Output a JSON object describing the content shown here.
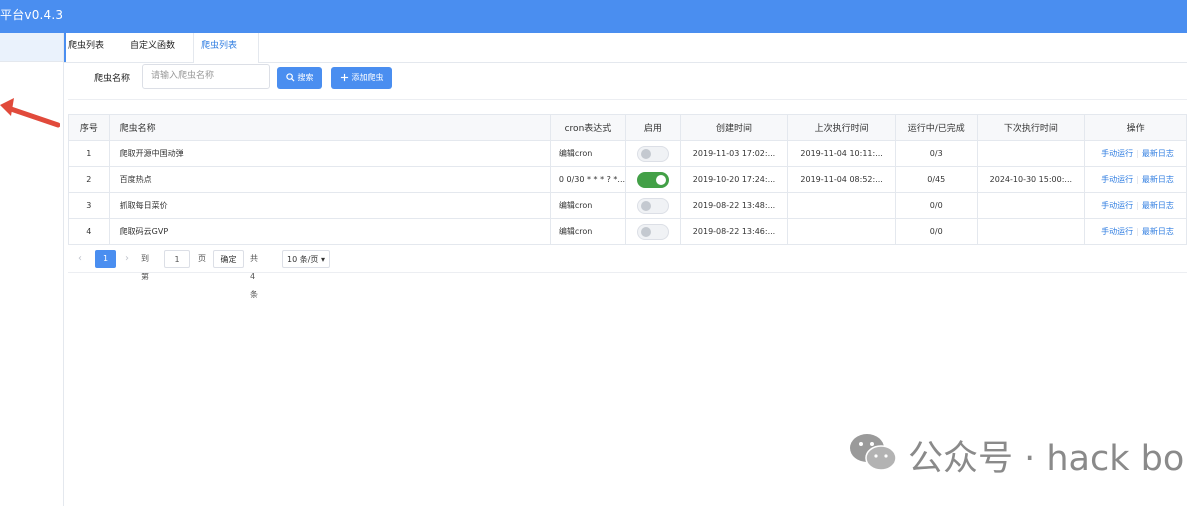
{
  "app": {
    "title": "平台v0.4.3"
  },
  "tabs": [
    {
      "label": "爬虫列表"
    },
    {
      "label": "自定义函数"
    },
    {
      "label": "爬虫列表"
    }
  ],
  "search": {
    "label": "爬虫名称",
    "placeholder": "请输入爬虫名称",
    "search_button": "搜索",
    "add_button": "添加爬虫"
  },
  "table": {
    "headers": [
      "序号",
      "爬虫名称",
      "cron表达式",
      "启用",
      "创建时间",
      "上次执行时间",
      "运行中/已完成",
      "下次执行时间",
      "操作"
    ],
    "rows": [
      {
        "index": "1",
        "name": "爬取开源中国动弹",
        "cron": "编辑cron",
        "enabled": false,
        "created": "2019-11-03 17:02:...",
        "last_run": "2019-11-04 10:11:...",
        "progress": "0/3",
        "next_run": "",
        "op_run": "手动运行",
        "op_log": "最新日志"
      },
      {
        "index": "2",
        "name": "百度热点",
        "cron": "0 0/30 * * * ? *...",
        "enabled": true,
        "created": "2019-10-20 17:24:...",
        "last_run": "2019-11-04 08:52:...",
        "progress": "0/45",
        "next_run": "2024-10-30 15:00:...",
        "op_run": "手动运行",
        "op_log": "最新日志"
      },
      {
        "index": "3",
        "name": "抓取每日菜价",
        "cron": "编辑cron",
        "enabled": false,
        "created": "2019-08-22 13:48:...",
        "last_run": "",
        "progress": "0/0",
        "next_run": "",
        "op_run": "手动运行",
        "op_log": "最新日志"
      },
      {
        "index": "4",
        "name": "爬取码云GVP",
        "cron": "编辑cron",
        "enabled": false,
        "created": "2019-08-22 13:46:...",
        "last_run": "",
        "progress": "0/0",
        "next_run": "",
        "op_run": "手动运行",
        "op_log": "最新日志"
      }
    ]
  },
  "pagination": {
    "current": "1",
    "goto_label": "到第",
    "goto_value": "1",
    "page_unit": "页",
    "confirm": "确定",
    "total": "共 4 条",
    "page_size": "10 条/页"
  },
  "watermark": {
    "text": "公众号 · hack bo"
  },
  "colors": {
    "primary": "#4a8ef0",
    "link": "#2f7de1",
    "switch_on": "#43a047",
    "annotation_arrow": "#e14a3b"
  }
}
